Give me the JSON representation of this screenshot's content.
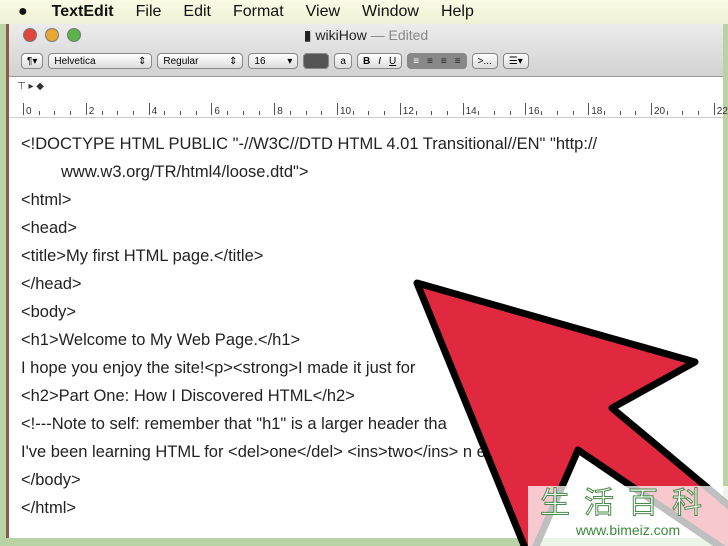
{
  "menubar": {
    "apple": "",
    "items": [
      "TextEdit",
      "File",
      "Edit",
      "Format",
      "View",
      "Window",
      "Help"
    ]
  },
  "window": {
    "title": "wikiHow",
    "status": "— Edited"
  },
  "toolbar": {
    "paragraph": "¶▾",
    "font": "Helvetica",
    "style": "Regular",
    "size": "16",
    "bg_char": "a",
    "bold": "B",
    "italic": "I",
    "underline": "U",
    "spacing": ">...",
    "list": "☰▾"
  },
  "ruler": {
    "labels": [
      "0",
      "2",
      "4",
      "6",
      "8",
      "10",
      "12",
      "14",
      "16",
      "18",
      "20",
      "22"
    ]
  },
  "document": {
    "lines": [
      "<!DOCTYPE HTML PUBLIC \"-//W3C//DTD HTML 4.01 Transitional//EN\" \"http://",
      "www.w3.org/TR/html4/loose.dtd\">",
      "<html>",
      "<head>",
      "<title>My first HTML page.</title>",
      "</head>",
      "<body>",
      "<h1>Welcome to My Web Page.</h1>",
      "I hope you enjoy the site!<p><strong>I made it just for",
      "<h2>Part One: How I Discovered HTML</h2>",
      "<!---Note to self: remember that \"h1\" is a larger header tha",
      "I've been learning HTML for <del>one</del> <ins>two</ins>                                   n expert.",
      "</body>",
      "</html>"
    ]
  },
  "watermark": {
    "chars": "生活百科",
    "url": "www.bimeiz.com"
  },
  "colors": {
    "arrow": "#e0283f",
    "border": "#b9d3a4"
  }
}
